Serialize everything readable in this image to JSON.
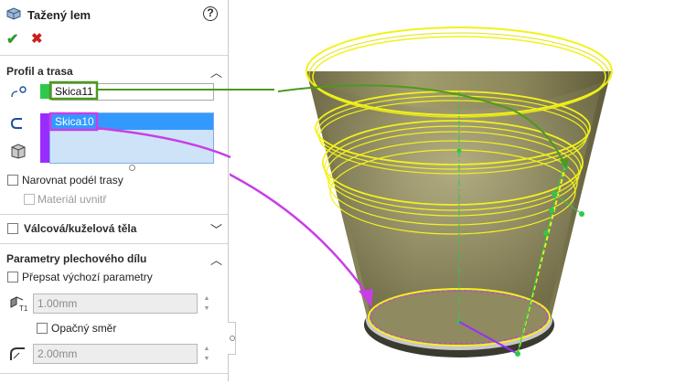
{
  "feature": {
    "title": "Tažený lem",
    "help_symbol": "?",
    "ok_symbol": "✔",
    "cancel_symbol": "✖"
  },
  "sections": {
    "profile_path": {
      "label": "Profil a trasa",
      "profile_value": "Skica11",
      "path_value": "Skica10",
      "profile_color": "#2ec94a",
      "path_color": "#9b2cff",
      "selected_color": "#3399ff",
      "checkbox_trim_along_path": "Narovnat podél trasy",
      "checkbox_material_inside": "Materiál uvnitř"
    },
    "cylindrical": {
      "label": "Válcová/kuželová těla"
    },
    "sheet_metal_params": {
      "label": "Parametry plechového dílu",
      "checkbox_override": "Přepsat výchozí parametry",
      "thickness_value": "1.00mm",
      "checkbox_reverse": "Opačný směr",
      "bend_radius_value": "2.00mm"
    }
  },
  "viewport": {
    "model_color": "#8a8558",
    "highlight_color": "#f2f21c",
    "green_callout_color": "#4c9a1e",
    "purple_callout_color": "#c83ee6"
  }
}
